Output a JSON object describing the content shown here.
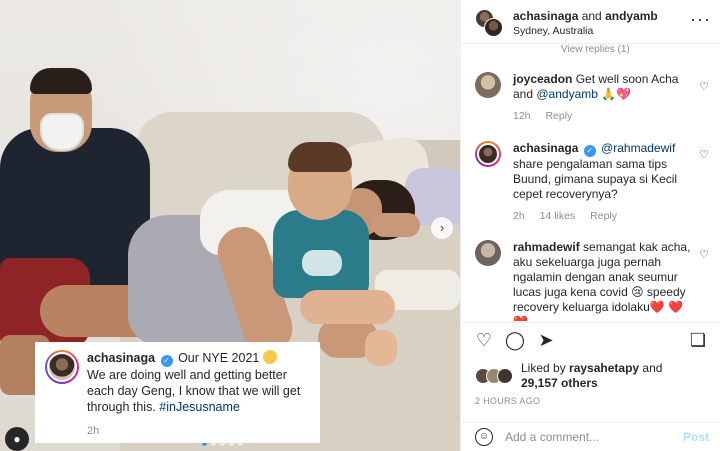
{
  "post": {
    "header": {
      "user1": "achasinaga",
      "and_text": " and ",
      "user2": "andyamb",
      "location": "Sydney, Australia",
      "more_icon": "more-horizontal-icon"
    },
    "caption": {
      "username": "achasinaga",
      "verified_icon": "verified-badge-icon",
      "text_line1": "Our NYE 2021",
      "emoji_icon": "grimacing-face-icon",
      "text_body": "We are doing well and getting better each day Geng, I know that we will get through this. ",
      "hashtag": "#inJesusname",
      "time": "2h"
    },
    "photo": {
      "next_icon": "chevron-right-icon",
      "user_tag_icon": "person-icon",
      "carousel_dots": 5,
      "active_dot": 1
    }
  },
  "comments": {
    "view_replies": "View replies (1)",
    "items": [
      {
        "username": "joyceadon",
        "text_before": "Get well soon Acha and ",
        "mention": "@andyamb",
        "text_after": " 🙏💖",
        "time": "12h",
        "likes": "",
        "reply": "Reply"
      },
      {
        "username": "achasinaga",
        "mention": "@rahmadewif",
        "text_after": " share pengalaman sama tips Buund, gimana supaya si Kecil cepet recoverynya?",
        "time": "2h",
        "likes": "14 likes",
        "reply": "Reply"
      },
      {
        "username": "rahmadewif",
        "text": "semangat kak acha, aku sekeluarga juga pernah ngalamin dengan anak seumur lucas juga kena covid 😢 speedy recovery keluarga idolaku❤️ ❤️❤️"
      }
    ],
    "heart_icon": "heart-icon"
  },
  "actions": {
    "like_icon": "heart-outline-icon",
    "comment_icon": "comment-icon",
    "share_icon": "paper-plane-icon",
    "save_icon": "bookmark-icon"
  },
  "likes": {
    "liked_by": "Liked by ",
    "liker": "raysahetapy",
    "and_text": "and",
    "others": "29,157 others"
  },
  "time_ago": "2 HOURS AGO",
  "add_comment": {
    "placeholder": "Add a comment...",
    "post_label": "Post",
    "emoji_icon": "smiley-icon"
  },
  "colors": {
    "accent_blue": "#3897f0",
    "link_blue": "#00376b",
    "muted": "#8e8e8e",
    "heart_red": "#ed4956"
  }
}
